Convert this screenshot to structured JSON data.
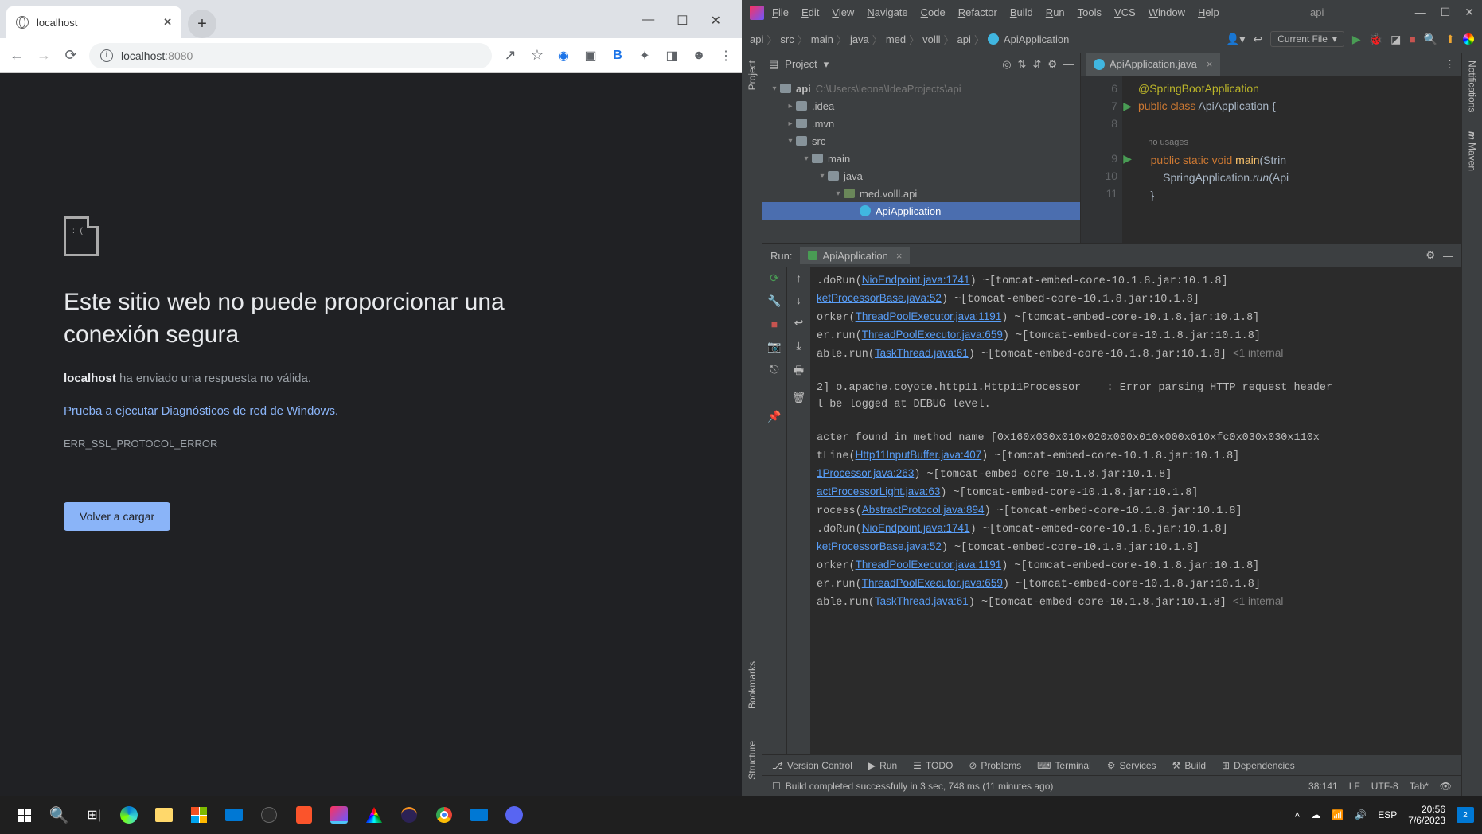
{
  "chrome": {
    "tab_title": "localhost",
    "url_host": "localhost",
    "url_port": ":8080",
    "error_heading": "Este sitio web no puede proporcionar una conexión segura",
    "error_sub_bold": "localhost",
    "error_sub_rest": " ha enviado una respuesta no válida.",
    "diag_link": "Prueba a ejecutar Diagnósticos de red de Windows",
    "error_code": "ERR_SSL_PROTOCOL_ERROR",
    "reload_button": "Volver a cargar"
  },
  "ide": {
    "menu": [
      "File",
      "Edit",
      "View",
      "Navigate",
      "Code",
      "Refactor",
      "Build",
      "Run",
      "Tools",
      "VCS",
      "Window",
      "Help"
    ],
    "window_title": "api",
    "breadcrumb": [
      "api",
      "src",
      "main",
      "java",
      "med",
      "volll",
      "api",
      "ApiApplication"
    ],
    "run_config": "Current File",
    "project_label": "Project",
    "tree": {
      "root": "api",
      "root_path": "C:\\Users\\leona\\IdeaProjects\\api",
      "children": [
        {
          "name": ".idea",
          "indent": 1,
          "expanded": false
        },
        {
          "name": ".mvn",
          "indent": 1,
          "expanded": false
        },
        {
          "name": "src",
          "indent": 1,
          "expanded": true
        },
        {
          "name": "main",
          "indent": 2,
          "expanded": true
        },
        {
          "name": "java",
          "indent": 3,
          "expanded": true
        },
        {
          "name": "med.volll.api",
          "indent": 4,
          "expanded": true,
          "pkg": true
        },
        {
          "name": "ApiApplication",
          "indent": 5,
          "class": true,
          "selected": true
        }
      ]
    },
    "editor_tab": "ApiApplication.java",
    "code": {
      "lines": [
        {
          "n": 6,
          "html": "<span class='kw-annot'>@SpringBootApplication</span>"
        },
        {
          "n": 7,
          "run": true,
          "html": "<span class='kw-orange'>public class </span>ApiApplication {"
        },
        {
          "n": 8,
          "html": ""
        },
        {
          "hint": "no usages"
        },
        {
          "n": 9,
          "run": true,
          "html": "    <span class='kw-orange'>public static void </span><span class='kw-yellow'>main</span>(Strin"
        },
        {
          "n": 10,
          "html": "        SpringApplication.<span class='kw-ital'>run</span>(Api"
        },
        {
          "n": 11,
          "html": "    }"
        }
      ]
    },
    "run_label": "Run:",
    "run_tab": "ApiApplication",
    "console": [
      {
        "pre": ".doRun(",
        "link": "NioEndpoint.java:1741",
        "post": ") ~[tomcat-embed-core-10.1.8.jar:10.1.8]"
      },
      {
        "pre": "",
        "link": "ketProcessorBase.java:52",
        "post": ") ~[tomcat-embed-core-10.1.8.jar:10.1.8]"
      },
      {
        "pre": "orker(",
        "link": "ThreadPoolExecutor.java:1191",
        "post": ") ~[tomcat-embed-core-10.1.8.jar:10.1.8]"
      },
      {
        "pre": "er.run(",
        "link": "ThreadPoolExecutor.java:659",
        "post": ") ~[tomcat-embed-core-10.1.8.jar:10.1.8]"
      },
      {
        "pre": "able.run(",
        "link": "TaskThread.java:61",
        "post": ") ~[tomcat-embed-core-10.1.8.jar:10.1.8] ",
        "gray": "<1 internal"
      },
      {
        "blank": true
      },
      {
        "raw": "2] o.apache.coyote.http11.Http11Processor    : Error parsing HTTP request header"
      },
      {
        "raw": "l be logged at DEBUG level."
      },
      {
        "blank": true
      },
      {
        "raw": "acter found in method name [0x160x030x010x020x000x010x000x010xfc0x030x030x110x"
      },
      {
        "pre": "tLine(",
        "link": "Http11InputBuffer.java:407",
        "post": ") ~[tomcat-embed-core-10.1.8.jar:10.1.8]"
      },
      {
        "pre": "",
        "link": "1Processor.java:263",
        "post": ") ~[tomcat-embed-core-10.1.8.jar:10.1.8]"
      },
      {
        "pre": "",
        "link": "actProcessorLight.java:63",
        "post": ") ~[tomcat-embed-core-10.1.8.jar:10.1.8]"
      },
      {
        "pre": "rocess(",
        "link": "AbstractProtocol.java:894",
        "post": ") ~[tomcat-embed-core-10.1.8.jar:10.1.8]"
      },
      {
        "pre": ".doRun(",
        "link": "NioEndpoint.java:1741",
        "post": ") ~[tomcat-embed-core-10.1.8.jar:10.1.8]"
      },
      {
        "pre": "",
        "link": "ketProcessorBase.java:52",
        "post": ") ~[tomcat-embed-core-10.1.8.jar:10.1.8]"
      },
      {
        "pre": "orker(",
        "link": "ThreadPoolExecutor.java:1191",
        "post": ") ~[tomcat-embed-core-10.1.8.jar:10.1.8]"
      },
      {
        "pre": "er.run(",
        "link": "ThreadPoolExecutor.java:659",
        "post": ") ~[tomcat-embed-core-10.1.8.jar:10.1.8]"
      },
      {
        "pre": "able.run(",
        "link": "TaskThread.java:61",
        "post": ") ~[tomcat-embed-core-10.1.8.jar:10.1.8] ",
        "gray": "<1 internal"
      }
    ],
    "bottom_tabs": [
      "Version Control",
      "Run",
      "TODO",
      "Problems",
      "Terminal",
      "Services",
      "Build",
      "Dependencies"
    ],
    "status_msg": "Build completed successfully in 3 sec, 748 ms (11 minutes ago)",
    "status_right": {
      "pos": "38:141",
      "eol": "LF",
      "enc": "UTF-8",
      "indent": "Tab*"
    },
    "side_tabs_left": [
      "Project",
      "Bookmarks",
      "Structure"
    ],
    "side_tabs_right": [
      "Notifications",
      "Maven"
    ]
  },
  "taskbar": {
    "lang": "ESP",
    "time": "20:56",
    "date": "7/6/2023",
    "notif_count": "2"
  }
}
